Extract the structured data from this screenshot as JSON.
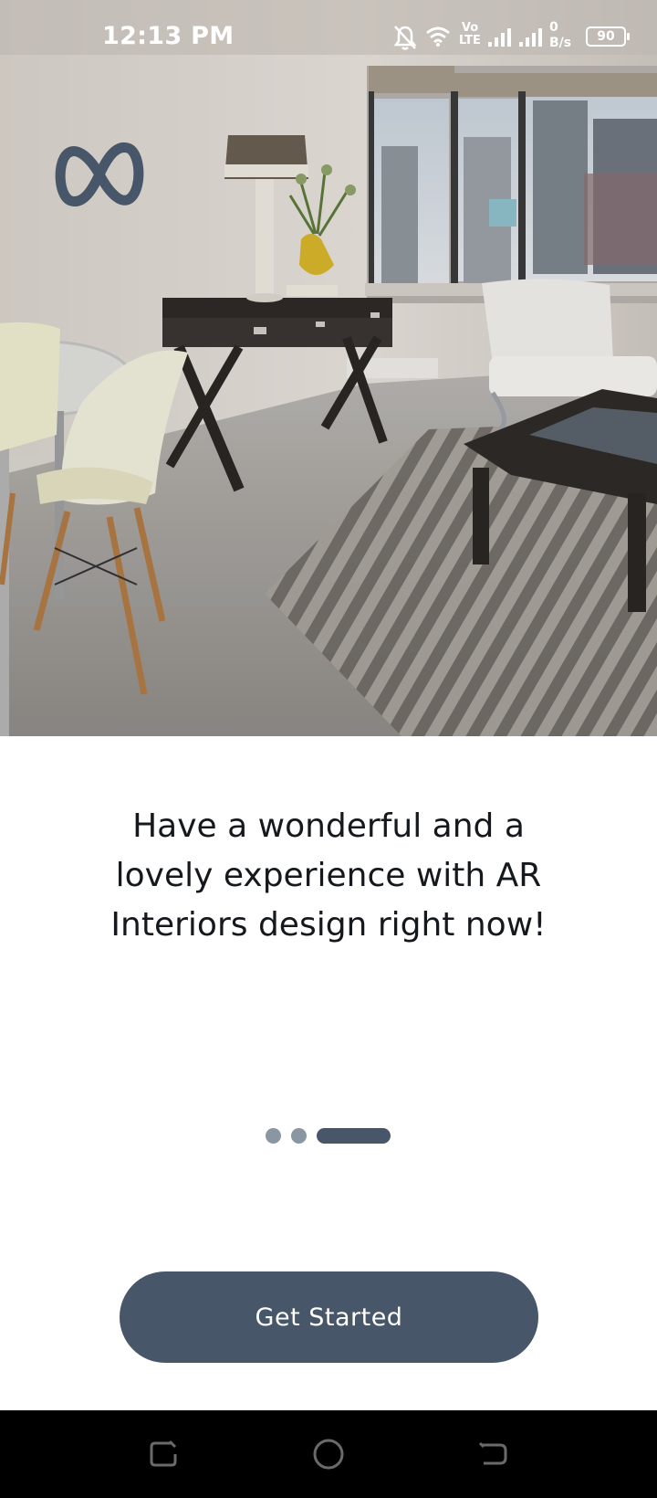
{
  "status_bar": {
    "time": "12:13 PM",
    "network_label": "Vo LTE",
    "net_speed_value": "0",
    "net_speed_unit": "B/s",
    "battery_level": "90",
    "icons": [
      "mute-notifications-icon",
      "wifi-icon",
      "volte-icon",
      "signal-icon",
      "signal-icon",
      "battery-icon"
    ]
  },
  "hero": {
    "image_description_icon": "living-room-photo",
    "logo_icon": "infinity-logo-icon"
  },
  "onboarding": {
    "headline_line1": "Have a wonderful and a",
    "headline_line2": "lovely experience with AR",
    "headline_line3": "Interiors design right now!",
    "page_count": 3,
    "active_page_index": 2,
    "cta_label": "Get Started"
  },
  "nav_bar": {
    "buttons": [
      "recents-icon",
      "home-icon",
      "back-icon"
    ]
  },
  "colors": {
    "accent": "#475668",
    "dot_inactive": "#8b96a3",
    "text": "#15181c",
    "background": "#ffffff"
  }
}
